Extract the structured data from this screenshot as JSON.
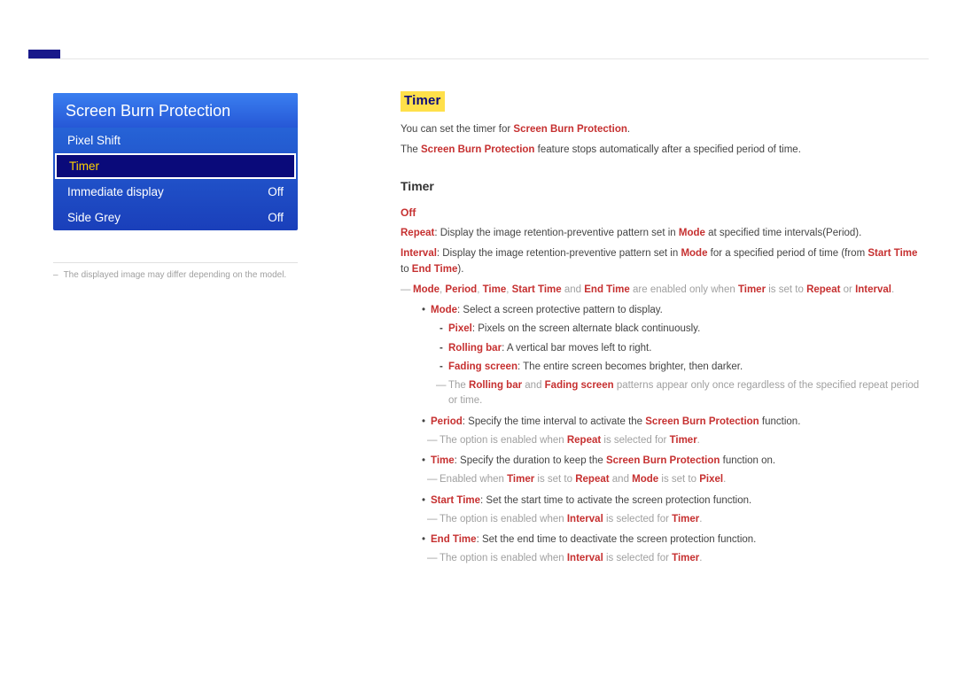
{
  "menu": {
    "title": "Screen Burn Protection",
    "items": [
      {
        "label": "Pixel Shift",
        "value": ""
      },
      {
        "label": "Timer",
        "value": ""
      },
      {
        "label": "Immediate display",
        "value": "Off"
      },
      {
        "label": "Side Grey",
        "value": "Off"
      }
    ],
    "note": "The displayed image may differ depending on the model."
  },
  "content": {
    "h1": "Timer",
    "intro1_a": "You can set the timer for ",
    "intro1_b": "Screen Burn Protection",
    "intro1_c": ".",
    "intro2_a": "The ",
    "intro2_b": "Screen Burn Protection",
    "intro2_c": " feature stops automatically after a specified period of time.",
    "sub": "Timer",
    "off": "Off",
    "repeat": {
      "k": "Repeat",
      "a": ": Display the image retention-preventive pattern set in ",
      "m": "Mode",
      "b": " at specified time intervals(Period)."
    },
    "interval": {
      "k": "Interval",
      "a": ": Display the image retention-preventive pattern set in ",
      "m": "Mode",
      "b": " for a specified period of time (from ",
      "st": "Start Time",
      "c": " to ",
      "et": "End Time",
      "d": ")."
    },
    "note1": {
      "a": "Mode",
      "b": ", ",
      "c": "Period",
      "d": ", ",
      "e": "Time",
      "f": ", ",
      "g": "Start Time",
      "h": " and ",
      "i": "End Time",
      "j": " are enabled only when ",
      "k": "Timer",
      "l": " is set to ",
      "m": "Repeat",
      "n": " or ",
      "o": "Interval",
      "p": "."
    },
    "mode_b": {
      "k": "Mode",
      "t": ": Select a screen protective pattern to display."
    },
    "pixel_d": {
      "k": "Pixel",
      "t": ": Pixels on the screen alternate black continuously."
    },
    "rolling_d": {
      "k": "Rolling bar",
      "t": ": A vertical bar moves left to right."
    },
    "fading_d": {
      "k": "Fading screen",
      "t": ": The entire screen becomes brighter, then darker."
    },
    "note2": {
      "a": "The ",
      "b": "Rolling bar",
      "c": " and ",
      "d": "Fading screen",
      "e": " patterns appear only once regardless of the specified repeat period or time."
    },
    "period_b": {
      "k": "Period",
      "a": ": Specify the time interval to activate the ",
      "b": "Screen Burn Protection",
      "c": " function."
    },
    "period_n": {
      "a": "The option is enabled when ",
      "b": "Repeat",
      "c": " is selected for ",
      "d": "Timer",
      "e": "."
    },
    "time_b": {
      "k": "Time",
      "a": ": Specify the duration to keep the ",
      "b": "Screen Burn Protection",
      "c": " function on."
    },
    "time_n": {
      "a": "Enabled when ",
      "b": "Timer",
      "c": " is set to ",
      "d": "Repeat",
      "e": " and ",
      "f": "Mode",
      "g": " is set to ",
      "h": "Pixel",
      "i": "."
    },
    "start_b": {
      "k": "Start Time",
      "t": ": Set the start time to activate the screen protection function."
    },
    "start_n": {
      "a": "The option is enabled when ",
      "b": "Interval",
      "c": " is selected for ",
      "d": "Timer",
      "e": "."
    },
    "end_b": {
      "k": "End Time",
      "t": ": Set the end time to deactivate the screen protection function."
    },
    "end_n": {
      "a": "The option is enabled when ",
      "b": "Interval",
      "c": " is selected for ",
      "d": "Timer",
      "e": "."
    }
  }
}
